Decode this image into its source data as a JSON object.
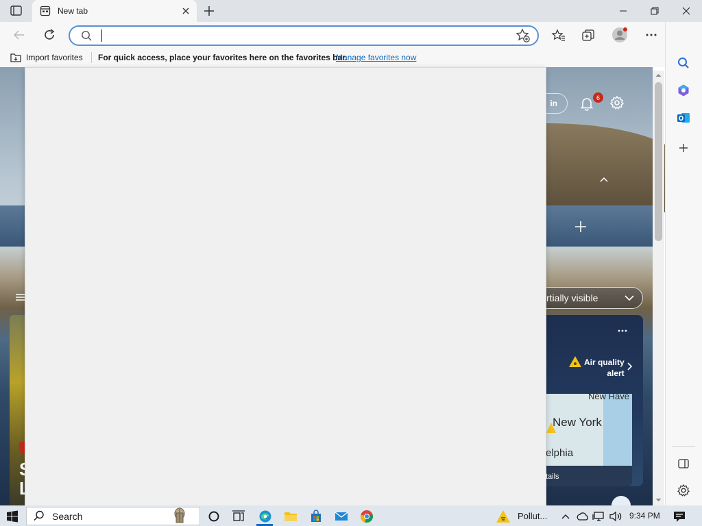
{
  "browser": {
    "tab": {
      "title": "New tab"
    },
    "address": {
      "value": ""
    },
    "favorites_bar": {
      "import_label": "Import favorites",
      "hint": "For quick access, place your favorites here on the favorites bar.",
      "manage_link": "Manage favorites now"
    }
  },
  "page": {
    "signin_label": "in",
    "notification_count": "6",
    "visibility_dropdown": "rtially visible",
    "weather": {
      "alert_line1": "Air quality",
      "alert_line2": "alert",
      "map_labels": {
        "ny": "New York",
        "nh": "New Have",
        "phl": "elphia"
      },
      "details": "tails"
    },
    "left_card_letters": [
      "S",
      "L"
    ]
  },
  "taskbar": {
    "search_label": "Search",
    "weather_text": "Pollut...",
    "clock": "9:34 PM"
  },
  "colors": {
    "accent": "#0f6cbd",
    "address_border": "#5a8fd6",
    "badge": "#c42b1c",
    "alert_yellow": "#f2c318"
  },
  "icons": {
    "sidebar": [
      "search-icon",
      "copilot-icon",
      "outlook-icon",
      "add-icon",
      "split-screen-icon",
      "settings-icon"
    ]
  }
}
